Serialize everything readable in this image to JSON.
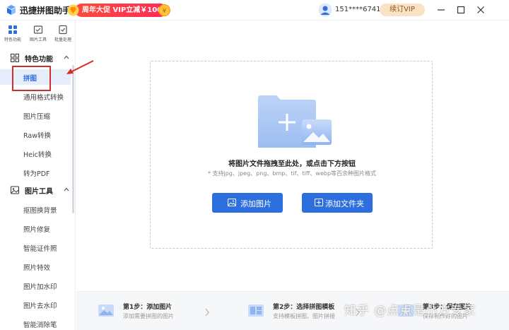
{
  "titlebar": {
    "app_title": "迅捷拼图助手",
    "promo_text": "周年大促 VIP立减￥100",
    "user_phone": "151****6741",
    "renew_label": "续订VIP"
  },
  "sidebar": {
    "topnav": [
      {
        "label": "特色功能"
      },
      {
        "label": "图片工具"
      },
      {
        "label": "批量处理"
      }
    ],
    "section_feature": "特色功能",
    "feature_items": [
      "拼图",
      "通用格式转换",
      "图片压缩",
      "Raw转换",
      "Heic转换",
      "转为PDF"
    ],
    "section_tools": "图片工具",
    "tool_items": [
      "抠图换背景",
      "照片修复",
      "智能证件照",
      "照片特效",
      "图片加水印",
      "图片去水印",
      "智能消除笔"
    ]
  },
  "dropzone": {
    "title": "将图片文件拖拽至此处，或点击下方按钮",
    "subtitle": "* 支持jpg、jpeg、png、bmp、tif、tiff、webp等百余种图片格式",
    "add_image": "添加图片",
    "add_folder": "添加文件夹"
  },
  "steps": [
    {
      "title": "第1步：添加图片",
      "desc": "添加需要拼图的图片"
    },
    {
      "title": "第2步：选择拼图模板",
      "desc": "支持模板拼图、图片拼接"
    },
    {
      "title": "第3步：保存图片",
      "desc": "保存制作好的图片"
    }
  ],
  "watermark": "知乎 @点点是小方专家",
  "colors": {
    "accent": "#2e6fe0",
    "promo": "#ff3b4a",
    "highlight": "#d62b2b",
    "renew_bg": "#fbe2c2"
  }
}
